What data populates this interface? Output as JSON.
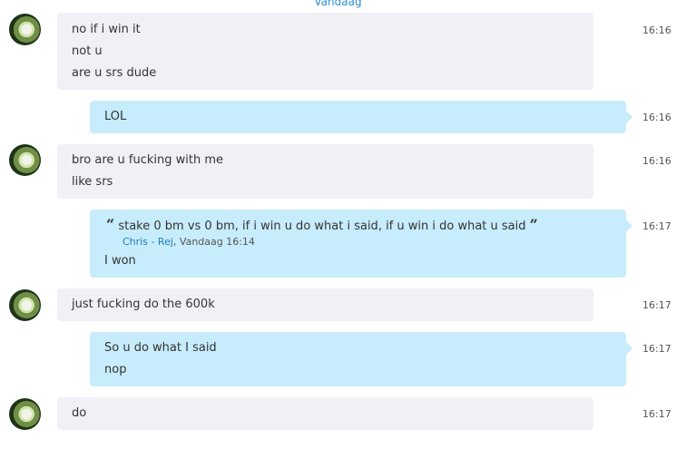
{
  "chat": {
    "day_divider": "Vandaag",
    "messages": [
      {
        "dir": "in",
        "time": "16:16",
        "lines": [
          "no if i win it",
          "not u",
          "are u srs dude"
        ]
      },
      {
        "dir": "out",
        "time": "16:16",
        "lines": [
          "LOL"
        ]
      },
      {
        "dir": "in",
        "time": "16:16",
        "lines": [
          "bro are u fucking with me",
          "like srs"
        ]
      },
      {
        "dir": "out",
        "time": "16:17",
        "quote": {
          "text": "stake 0 bm vs 0 bm, if i win u do what i said, if u win i do what u said",
          "author": "Chris - Rej",
          "timestamp": "Vandaag 16:14",
          "open_mark": "“",
          "close_mark": "”"
        },
        "lines": [
          "I won"
        ]
      },
      {
        "dir": "in",
        "time": "16:17",
        "lines": [
          "just fucking do the 600k"
        ]
      },
      {
        "dir": "out",
        "time": "16:17",
        "lines": [
          "So u do what I said",
          "nop"
        ]
      },
      {
        "dir": "in",
        "time": "16:17",
        "lines": [
          "do"
        ]
      }
    ]
  }
}
